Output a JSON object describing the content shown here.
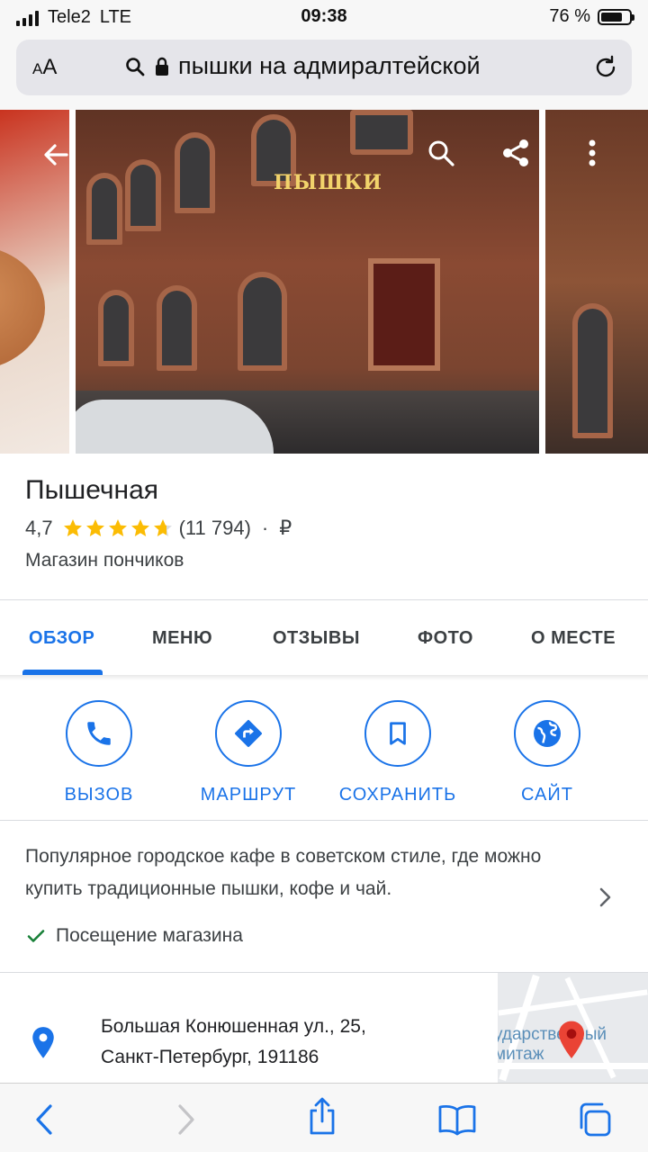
{
  "status": {
    "carrier": "Tele2",
    "network": "LTE",
    "time": "09:38",
    "battery": "76 %",
    "battery_level": 0.76
  },
  "browser": {
    "aa_label": "AA",
    "url": "пышки на адмиралтейской"
  },
  "gallery": {
    "sign_text": "ПЫШКИ"
  },
  "place": {
    "title": "Пышечная",
    "rating": "4,7",
    "rating_value": 4.7,
    "reviews_count": "(11 794)",
    "separator": "·",
    "price": "₽",
    "category": "Магазин пончиков"
  },
  "tabs": [
    {
      "label": "ОБЗОР",
      "active": true
    },
    {
      "label": "МЕНЮ",
      "active": false
    },
    {
      "label": "ОТЗЫВЫ",
      "active": false
    },
    {
      "label": "ФОТО",
      "active": false
    },
    {
      "label": "О МЕСТЕ",
      "active": false
    }
  ],
  "actions": [
    {
      "label": "ВЫЗОВ",
      "icon": "phone-icon"
    },
    {
      "label": "МАРШРУТ",
      "icon": "directions-icon"
    },
    {
      "label": "СОХРАНИТЬ",
      "icon": "bookmark-icon"
    },
    {
      "label": "САЙТ",
      "icon": "globe-icon"
    }
  ],
  "description": {
    "text": "Популярное городское кафе в советском стиле, где можно купить традиционные пышки, кофе и чай.",
    "feature": "Посещение магазина"
  },
  "address": {
    "line1": "Большая Конюшенная ул., 25,",
    "line2": "Санкт-Петербург, 191186",
    "map_label_1": "ударственный",
    "map_label_2": "митаж"
  },
  "colors": {
    "accent": "#1a73e8",
    "star": "#fbbc04",
    "check": "#188038",
    "pin": "#ea4335"
  }
}
